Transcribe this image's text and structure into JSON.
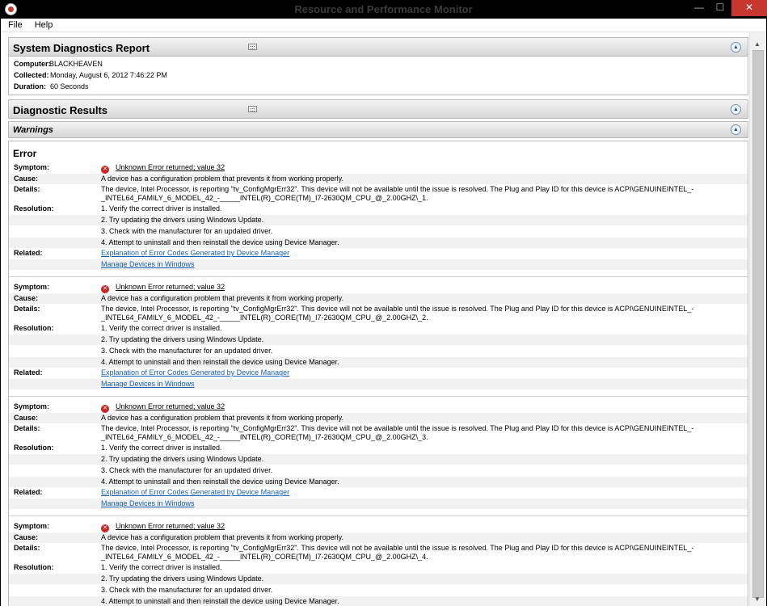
{
  "window": {
    "title": "Resource and Performance Monitor",
    "min": "—",
    "max": "☐",
    "close": "✕"
  },
  "menu": [
    "File",
    "Help"
  ],
  "report": {
    "title": "System Diagnostics Report",
    "computer_label": "Computer:",
    "computer": "BLACKHEAVEN",
    "collected_label": "Collected:",
    "collected": "Monday, August 6, 2012 7:46:22 PM",
    "duration_label": "Duration:",
    "duration": "60 Seconds"
  },
  "results": {
    "title": "Diagnostic Results",
    "warnings": "Warnings",
    "error_title": "Error"
  },
  "labels": {
    "symptom": "Symptom:",
    "cause": "Cause:",
    "details": "Details:",
    "resolution": "Resolution:",
    "related": "Related:"
  },
  "errors": [
    {
      "symptom": "Unknown Error returned; value 32",
      "cause": "A device has a configuration problem that prevents it from working properly.",
      "details_1": "The device, Intel Processor, is reporting \"tv_ConfigMgrErr32\". This device will not be available until the issue is resolved. The Plug and Play ID for this device is ACPI\\GENUINEINTEL_-",
      "details_2": "_INTEL64_FAMILY_6_MODEL_42_-_____INTEL(R)_CORE(TM)_I7-2630QM_CPU_@_2.00GHZ\\_1.",
      "resolution": [
        "1. Verify the correct driver is installed.",
        "2. Try updating the drivers using Windows Update.",
        "3. Check with the manufacturer for an updated driver.",
        "4. Attempt to uninstall and then reinstall the device using Device Manager."
      ],
      "related": [
        "Explanation of Error Codes Generated by Device Manager",
        "Manage Devices in Windows"
      ]
    },
    {
      "symptom": "Unknown Error returned; value 32",
      "cause": "A device has a configuration problem that prevents it from working properly.",
      "details_1": "The device, Intel Processor, is reporting \"tv_ConfigMgrErr32\". This device will not be available until the issue is resolved. The Plug and Play ID for this device is ACPI\\GENUINEINTEL_-",
      "details_2": "_INTEL64_FAMILY_6_MODEL_42_-_____INTEL(R)_CORE(TM)_I7-2630QM_CPU_@_2.00GHZ\\_2.",
      "resolution": [
        "1. Verify the correct driver is installed.",
        "2. Try updating the drivers using Windows Update.",
        "3. Check with the manufacturer for an updated driver.",
        "4. Attempt to uninstall and then reinstall the device using Device Manager."
      ],
      "related": [
        "Explanation of Error Codes Generated by Device Manager",
        "Manage Devices in Windows"
      ]
    },
    {
      "symptom": "Unknown Error returned; value 32",
      "cause": "A device has a configuration problem that prevents it from working properly.",
      "details_1": "The device, Intel Processor, is reporting \"tv_ConfigMgrErr32\". This device will not be available until the issue is resolved. The Plug and Play ID for this device is ACPI\\GENUINEINTEL_-",
      "details_2": "_INTEL64_FAMILY_6_MODEL_42_-_____INTEL(R)_CORE(TM)_I7-2630QM_CPU_@_2.00GHZ\\_3.",
      "resolution": [
        "1. Verify the correct driver is installed.",
        "2. Try updating the drivers using Windows Update.",
        "3. Check with the manufacturer for an updated driver.",
        "4. Attempt to uninstall and then reinstall the device using Device Manager."
      ],
      "related": [
        "Explanation of Error Codes Generated by Device Manager",
        "Manage Devices in Windows"
      ]
    },
    {
      "symptom": "Unknown Error returned; value 32",
      "cause": "A device has a configuration problem that prevents it from working properly.",
      "details_1": "The device, Intel Processor, is reporting \"tv_ConfigMgrErr32\". This device will not be available until the issue is resolved. The Plug and Play ID for this device is ACPI\\GENUINEINTEL_-",
      "details_2": "_INTEL64_FAMILY_6_MODEL_42_-_____INTEL(R)_CORE(TM)_I7-2630QM_CPU_@_2.00GHZ\\_4.",
      "resolution": [
        "1. Verify the correct driver is installed.",
        "2. Try updating the drivers using Windows Update.",
        "3. Check with the manufacturer for an updated driver.",
        "4. Attempt to uninstall and then reinstall the device using Device Manager."
      ],
      "related": []
    }
  ],
  "icons": {
    "app": "resmon-icon",
    "collapse": "collapse-up-icon",
    "grip": "section-grip-icon",
    "error": "error-icon"
  },
  "colors": {
    "link": "#1a5fb4",
    "error": "#c62828",
    "close": "#c7372f"
  }
}
